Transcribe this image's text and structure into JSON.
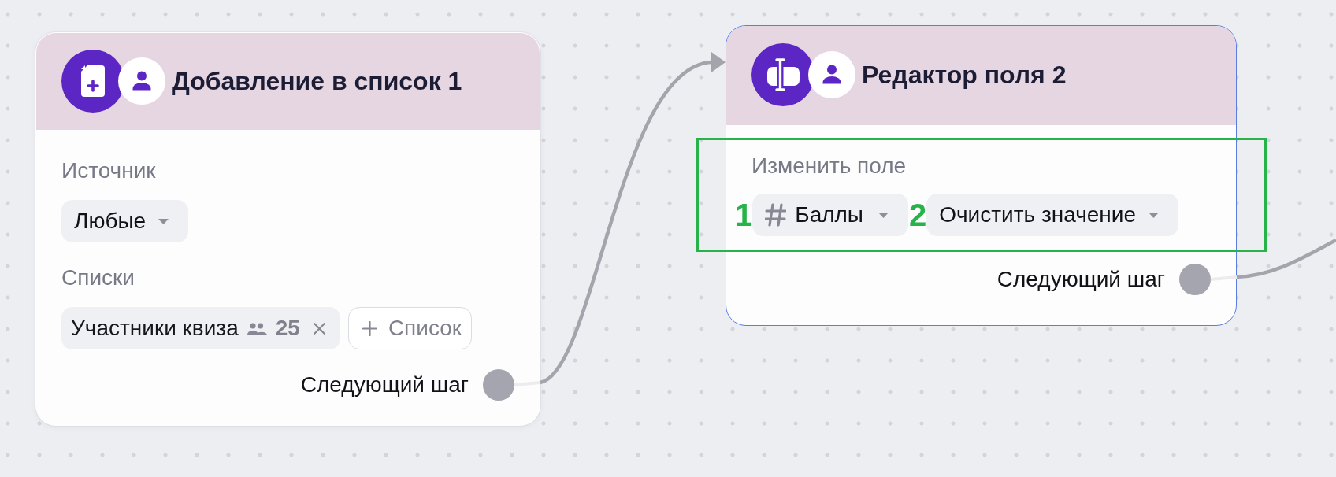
{
  "nodes": [
    {
      "kind": "add_to_list",
      "title": "Добавление в список 1",
      "selected": false,
      "sections": [
        {
          "label": "Источник",
          "highlighted": false,
          "controls": [
            {
              "kind": "dropdown",
              "value": "Любые"
            }
          ]
        },
        {
          "label": "Списки",
          "highlighted": false,
          "controls": [
            {
              "kind": "tag",
              "text": "Участники квиза",
              "count": "25"
            },
            {
              "kind": "add_button",
              "text": "Список"
            }
          ]
        }
      ],
      "output": "Следующий шаг"
    },
    {
      "kind": "field_editor",
      "title": "Редактор поля 2",
      "selected": true,
      "sections": [
        {
          "label": "Изменить поле",
          "highlighted": true,
          "controls": [
            {
              "kind": "field_dropdown",
              "value": "Баллы",
              "marker": "1"
            },
            {
              "kind": "dropdown",
              "value": "Очистить значение",
              "marker": "2"
            }
          ]
        }
      ],
      "output": "Следующий шаг"
    }
  ]
}
